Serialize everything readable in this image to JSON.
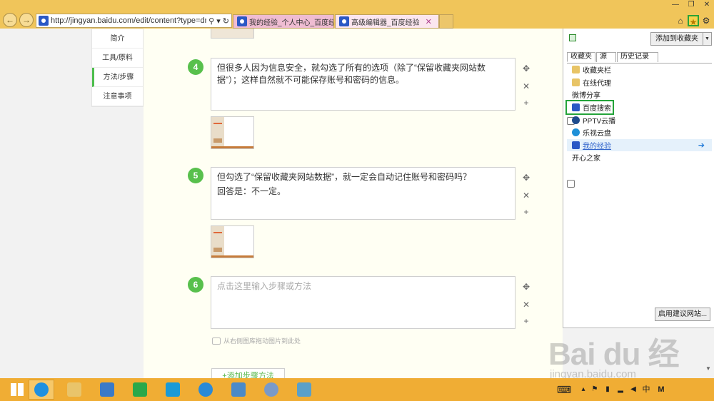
{
  "window": {
    "minimize": "—",
    "restore": "❐",
    "close": "✕"
  },
  "browser": {
    "url": "http://jingyan.baidu.com/edit/content?type=draft",
    "addr_tools": "⚲ ▾ ↻",
    "tabs": [
      {
        "label": "我的经验_个人中心_百度经验"
      },
      {
        "label": "高级编辑器_百度经验",
        "close": "✕"
      }
    ],
    "icons": {
      "home": "⌂",
      "favorites": "★",
      "tools": "⚙"
    }
  },
  "sidenav": [
    {
      "label": "简介"
    },
    {
      "label": "工具/原料"
    },
    {
      "label": "方法/步骤"
    },
    {
      "label": "注意事项"
    }
  ],
  "steps": [
    {
      "num": "4",
      "text": "但很多人因为信息安全，就勾选了所有的选项（除了“保留收藏夹网站数据”）；这样自然就不可能保存账号和密码的信息。"
    },
    {
      "num": "5",
      "line1": "但勾选了“保留收藏夹网站数据”，就一定会自动记住账号和密码吗？",
      "line2": "回答是：不一定。"
    },
    {
      "num": "6",
      "placeholder": "点击这里输入步骤或方法"
    }
  ],
  "tools": {
    "move": "✥",
    "delete": "✕",
    "add": "+"
  },
  "editor": {
    "image_hint": "从右侧图库拖动图片到此处",
    "add_step": "+添加步骤方法"
  },
  "favorites": {
    "add_button": "添加到收藏夹",
    "dropdown": "▼",
    "tabs": [
      "收藏夹",
      "源",
      "历史记录"
    ],
    "items": [
      {
        "label": "收藏夹栏",
        "icon": "folder"
      },
      {
        "label": "在线代理",
        "icon": "folder"
      },
      {
        "label": "微博分享",
        "icon": "page"
      },
      {
        "label": "百度搜索",
        "icon": "baidu"
      },
      {
        "label": "PPTV云播",
        "icon": "pptv"
      },
      {
        "label": "乐视云盘",
        "icon": "cloud"
      },
      {
        "label": "我的经验",
        "icon": "baidu"
      },
      {
        "label": "开心之家",
        "icon": "page"
      }
    ],
    "arrow": "➔",
    "suggest_button": "启用建议网站..."
  },
  "watermark": {
    "logo": "Bai du 经验",
    "url": "jingyan.baidu.com"
  },
  "taskbar": {
    "tray": {
      "keyboard": "⌨",
      "flag": "⚑",
      "ime": "中",
      "m": "M"
    }
  },
  "colors": {
    "chrome": "#f0c55a",
    "taskbar": "#f0ad34",
    "step_badge": "#58c04c",
    "highlight": "#24a33a",
    "editor_bg": "#fffff3"
  }
}
